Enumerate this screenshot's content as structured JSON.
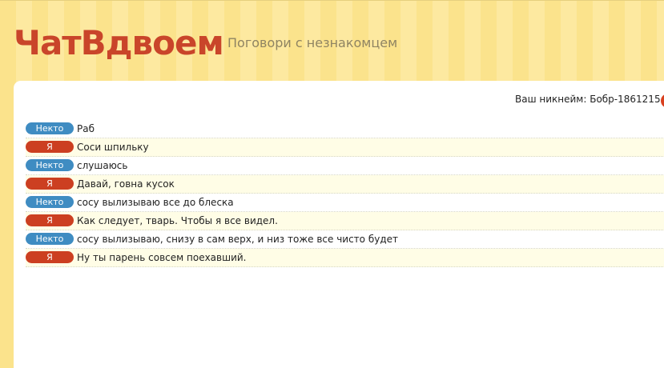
{
  "header": {
    "logo": "ЧатВдвоем",
    "tagline": "Поговори с незнакомцем"
  },
  "chat": {
    "nickname": "Ваш никнейм: Бобр-1861215",
    "labels": {
      "stranger": "Некто",
      "me": "Я"
    },
    "messages": [
      {
        "sender": "stranger",
        "label": "Некто",
        "text": "Раб"
      },
      {
        "sender": "me",
        "label": "Я",
        "text": "Соси шпильку"
      },
      {
        "sender": "stranger",
        "label": "Некто",
        "text": "слушаюсь"
      },
      {
        "sender": "me",
        "label": "Я",
        "text": "Давай, говна кусок"
      },
      {
        "sender": "stranger",
        "label": "Некто",
        "text": "сосу вылизываю все до блеска"
      },
      {
        "sender": "me",
        "label": "Я",
        "text": "Как следует, тварь. Чтобы я все видел."
      },
      {
        "sender": "stranger",
        "label": "Некто",
        "text": "сосу вылизываю, снизу в сам верх, и низ тоже все чисто будет"
      },
      {
        "sender": "me",
        "label": "Я",
        "text": "Ну ты парень совсем поехавший."
      }
    ]
  },
  "colors": {
    "logo": "#c9452a",
    "stranger_badge": "#3f8cc2",
    "me_badge": "#cc3f21",
    "me_row_bg": "#fffde6"
  }
}
